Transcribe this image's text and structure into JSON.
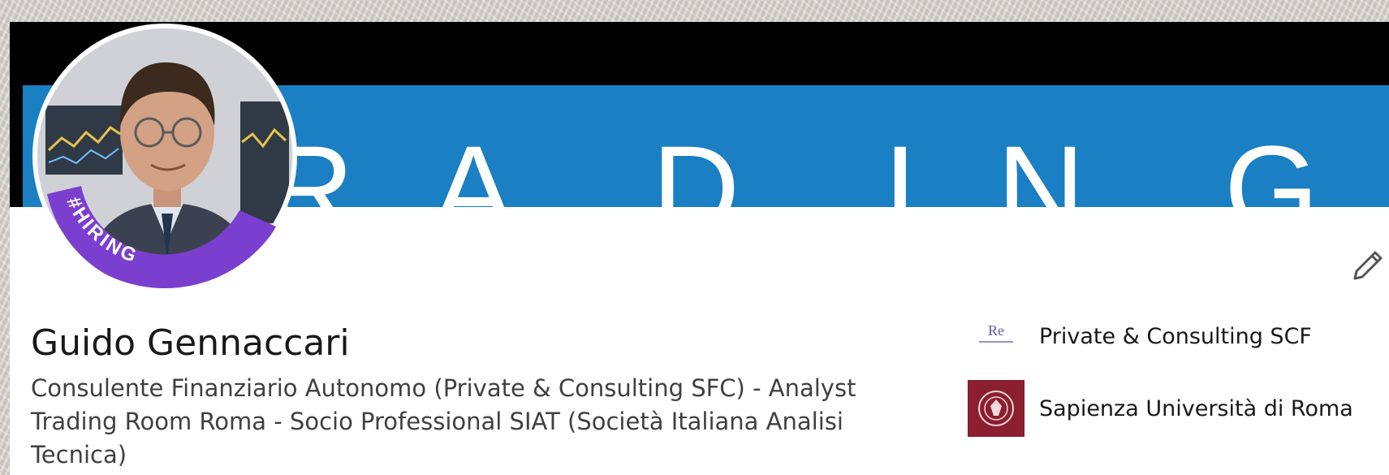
{
  "banner": {
    "letters": [
      "R",
      "A",
      "D",
      "I",
      "N",
      "G"
    ],
    "background": "#000000",
    "accent": "#1a7fc3"
  },
  "avatar": {
    "badge_text": "#HIRING",
    "badge_color": "#7b3fcf"
  },
  "actions": {
    "edit_icon": "pencil-icon"
  },
  "profile": {
    "name": "Guido Gennaccari",
    "headline": "Consulente Finanziario Autonomo (Private & Consulting SFC) - Analyst Trading Room Roma - Socio Professional SIAT (Società Italiana Analisi Tecnica)"
  },
  "affiliations": [
    {
      "label": "Private & Consulting SCF",
      "logo_text": "Re",
      "icon": "company-logo-icon"
    },
    {
      "label": "Sapienza Università di Roma",
      "icon": "university-seal-icon",
      "color": "#8b1e2f"
    }
  ]
}
